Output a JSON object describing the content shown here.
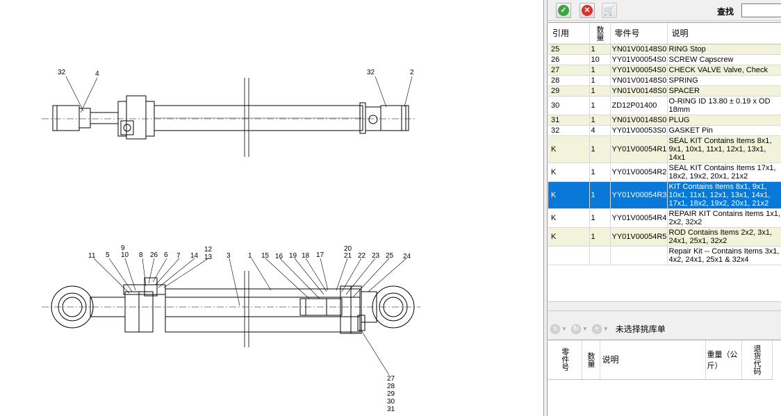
{
  "drawing": {
    "top_callouts": [
      "32",
      "4",
      "32",
      "2"
    ],
    "bottom_callouts": [
      "9",
      "10",
      "11",
      "5",
      "8",
      "26",
      "6",
      "7",
      "14",
      "12",
      "13",
      "3",
      "1",
      "15",
      "16",
      "19",
      "18",
      "17",
      "20",
      "21",
      "22",
      "23",
      "25",
      "24"
    ],
    "bottom_stack": [
      "27",
      "28",
      "29",
      "30",
      "31"
    ]
  },
  "toolbar": {
    "confirm_icon": "green-check-icon",
    "cancel_icon": "red-x-icon",
    "cart_icon": "cart-icon",
    "search_label": "查找",
    "search_value": ""
  },
  "parts_table": {
    "columns": [
      "引用",
      "数量",
      "零件号",
      "说明"
    ],
    "rows": [
      {
        "ref": "25",
        "qty": "1",
        "part": "YN01V00148S0",
        "desc": "RING Stop",
        "style": "alt"
      },
      {
        "ref": "26",
        "qty": "10",
        "part": "YY01V00054S0",
        "desc": "SCREW Capscrew",
        "style": ""
      },
      {
        "ref": "27",
        "qty": "1",
        "part": "YY01V00054S0",
        "desc": "CHECK VALVE Valve, Check",
        "style": "alt"
      },
      {
        "ref": "28",
        "qty": "1",
        "part": "YN01V00148S0",
        "desc": "SPRING",
        "style": ""
      },
      {
        "ref": "29",
        "qty": "1",
        "part": "YN01V00148S0",
        "desc": "SPACER",
        "style": "alt"
      },
      {
        "ref": "30",
        "qty": "1",
        "part": "ZD12P01400",
        "desc": "O-RING ID 13.80 ± 0.19 x OD 18mm",
        "style": ""
      },
      {
        "ref": "31",
        "qty": "1",
        "part": "YN01V00148S0",
        "desc": "PLUG",
        "style": "alt"
      },
      {
        "ref": "32",
        "qty": "4",
        "part": "YY01V00053S0",
        "desc": "GASKET Pin",
        "style": ""
      },
      {
        "ref": "K",
        "qty": "1",
        "part": "YY01V00054R1",
        "desc": "SEAL KIT Contains Items 8x1, 9x1, 10x1, 11x1, 12x1, 13x1, 14x1",
        "style": "alt"
      },
      {
        "ref": "K",
        "qty": "1",
        "part": "YY01V00054R2",
        "desc": "SEAL KIT Contains Items 17x1, 18x2, 19x2, 20x1, 21x2",
        "style": ""
      },
      {
        "ref": "K",
        "qty": "1",
        "part": "YY01V00054R3",
        "desc": "KIT Contains Items 8x1, 9x1, 10x1, 11x1, 12x1, 13x1, 14x1, 17x1, 18x2, 19x2, 20x1, 21x2",
        "style": "sel"
      },
      {
        "ref": "K",
        "qty": "1",
        "part": "YY01V00054R4",
        "desc": "REPAIR KIT Contains Items 1x1, 2x2, 32x2",
        "style": ""
      },
      {
        "ref": "K",
        "qty": "1",
        "part": "YY01V00054R5",
        "desc": "ROD Contains Items 2x2, 3x1, 24x1, 25x1, 32x2",
        "style": "alt"
      },
      {
        "ref": "",
        "qty": "",
        "part": "",
        "desc": "Repair Kit -- Contains Items 3x1, 4x2, 24x1, 25x1 & 32x4",
        "style": ""
      }
    ]
  },
  "pick_list": {
    "status": "未选择挑库单",
    "columns": [
      "零件号",
      "数量",
      "说明",
      "重量（公斤）",
      "退货代码"
    ]
  },
  "colors": {
    "row_alt": "#f3f3dc",
    "row_selected": "#0a78d7"
  }
}
